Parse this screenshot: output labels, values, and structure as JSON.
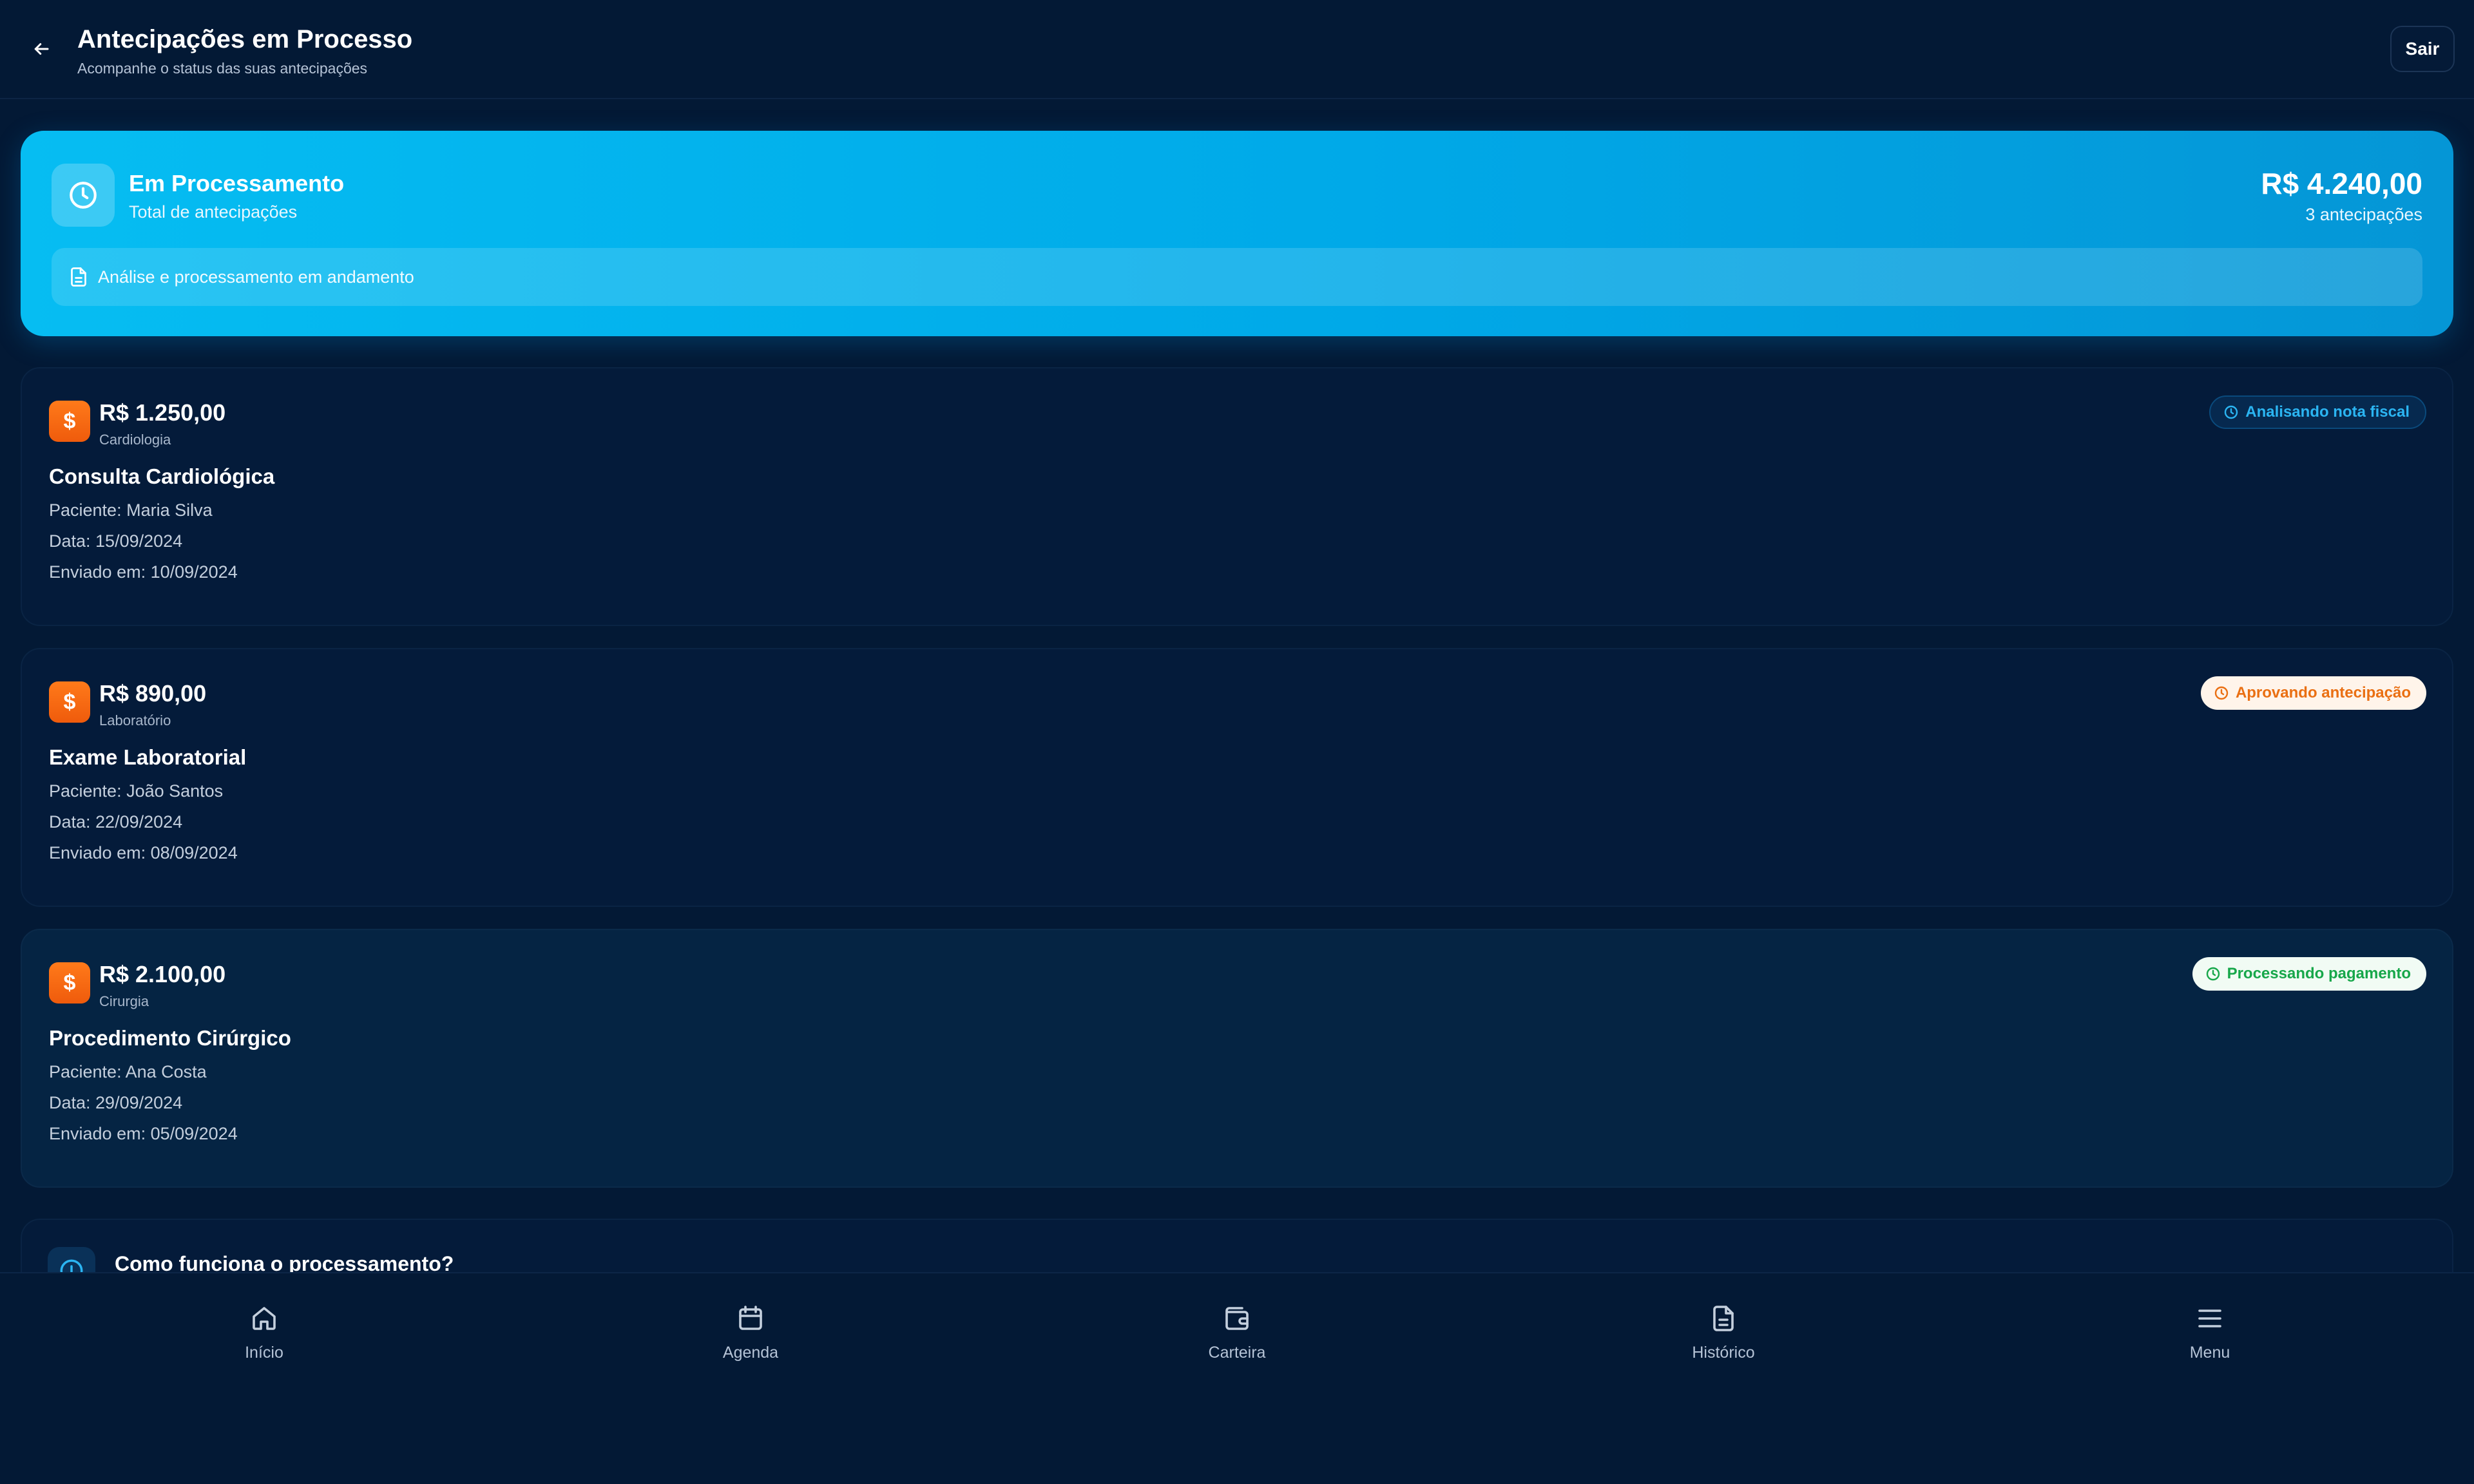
{
  "header": {
    "title": "Antecipações em Processo",
    "subtitle": "Acompanhe o status das suas antecipações",
    "logout_label": "Sair",
    "back_icon": "arrow-left-icon"
  },
  "summary": {
    "title": "Em Processamento",
    "subtitle": "Total de antecipações",
    "total": "R$ 4.240,00",
    "count": "3 antecipações",
    "banner": "Análise e processamento em andamento",
    "icon": "clock-icon",
    "colors": {
      "gradient_start": "#06bdf2",
      "gradient_end": "#0596d6"
    }
  },
  "requests": [
    {
      "amount": "R$ 1.250,00",
      "category": "Cardiologia",
      "title": "Consulta Cardiológica",
      "patient": "Paciente: Maria Silva",
      "date": "Data: 15/09/2024",
      "sent": "Enviado em: 10/09/2024",
      "status": "Analisando nota fiscal",
      "status_color": "#2bb5f2"
    },
    {
      "amount": "R$ 890,00",
      "category": "Laboratório",
      "title": "Exame Laboratorial",
      "patient": "Paciente: João Santos",
      "date": "Data: 22/09/2024",
      "sent": "Enviado em: 08/09/2024",
      "status": "Aprovando antecipação",
      "status_color": "#ea6f12"
    },
    {
      "amount": "R$ 2.100,00",
      "category": "Cirurgia",
      "title": "Procedimento Cirúrgico",
      "patient": "Paciente: Ana Costa",
      "date": "Data: 29/09/2024",
      "sent": "Enviado em: 05/09/2024",
      "status": "Processando pagamento",
      "status_color": "#17a74a"
    }
  ],
  "info": {
    "title": "Como funciona o processamento?",
    "icon": "info-icon"
  },
  "nav": [
    {
      "label": "Início",
      "icon": "home-icon"
    },
    {
      "label": "Agenda",
      "icon": "calendar-icon"
    },
    {
      "label": "Carteira",
      "icon": "wallet-icon"
    },
    {
      "label": "Histórico",
      "icon": "document-icon"
    },
    {
      "label": "Menu",
      "icon": "menu-icon"
    }
  ],
  "colors": {
    "background": "#031935",
    "accent": "#00a9e8",
    "request_icon": "#f26a12"
  }
}
